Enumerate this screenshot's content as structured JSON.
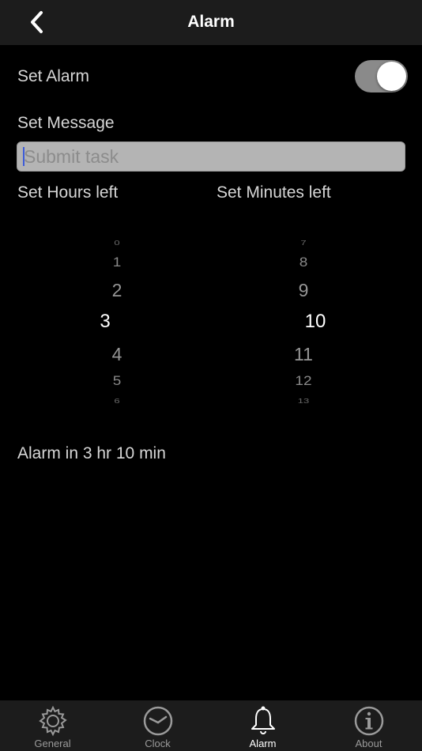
{
  "nav": {
    "title": "Alarm"
  },
  "alarm": {
    "label": "Set Alarm",
    "enabled": true
  },
  "message": {
    "label": "Set Message",
    "placeholder": "Submit task",
    "value": ""
  },
  "hours": {
    "label": "Set Hours left",
    "items": [
      "0",
      "1",
      "2",
      "3",
      "4",
      "5",
      "6"
    ],
    "selected": "3"
  },
  "minutes": {
    "label": "Set Minutes left",
    "items": [
      "7",
      "8",
      "9",
      "10",
      "11",
      "12",
      "13"
    ],
    "selected": "10"
  },
  "status": "Alarm in 3 hr 10 min",
  "tabs": [
    {
      "label": "General",
      "icon": "gear-icon",
      "active": false
    },
    {
      "label": "Clock",
      "icon": "clock-icon",
      "active": false
    },
    {
      "label": "Alarm",
      "icon": "bell-icon",
      "active": true
    },
    {
      "label": "About",
      "icon": "info-icon",
      "active": false
    }
  ]
}
